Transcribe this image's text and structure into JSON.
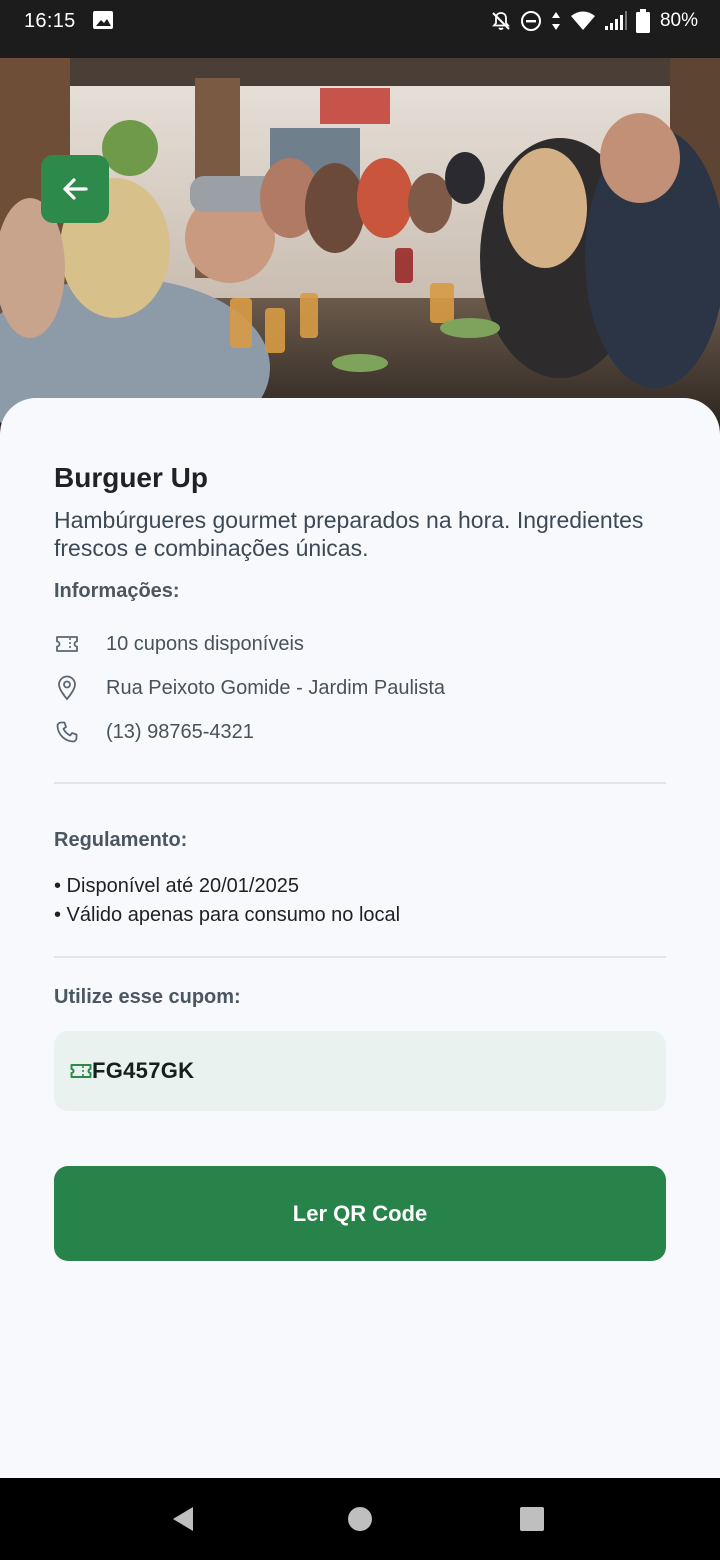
{
  "status_bar": {
    "time": "16:15",
    "battery": "80%",
    "icons": [
      "gallery-icon",
      "notifications-off-icon",
      "do-not-disturb-icon",
      "data-arrows-icon",
      "wifi-icon",
      "signal-icon",
      "battery-icon"
    ]
  },
  "header": {
    "back_icon": "arrow-left-icon"
  },
  "store": {
    "name": "Burguer Up",
    "description": "Hambúrgueres gourmet preparados na hora. Ingredientes frescos e combinações únicas."
  },
  "info": {
    "label": "Informações:",
    "coupons": "10 cupons disponíveis",
    "address": "Rua Peixoto Gomide - Jardim Paulista",
    "phone": "(13) 98765-4321"
  },
  "rules": {
    "label": "Regulamento:",
    "items": [
      "• Disponível até 20/01/2025",
      "• Válido apenas para consumo no local"
    ]
  },
  "coupon": {
    "label": "Utilize esse cupom:",
    "code": "FG457GK"
  },
  "actions": {
    "qr_button": "Ler QR Code"
  },
  "nav": {
    "back": "nav-back-icon",
    "home": "nav-home-icon",
    "recents": "nav-recents-icon"
  },
  "colors": {
    "accent": "#27834a",
    "back_button": "#2e8a4b",
    "coupon_bg": "#e9f2ef",
    "sheet_bg": "#f8f9fd"
  }
}
